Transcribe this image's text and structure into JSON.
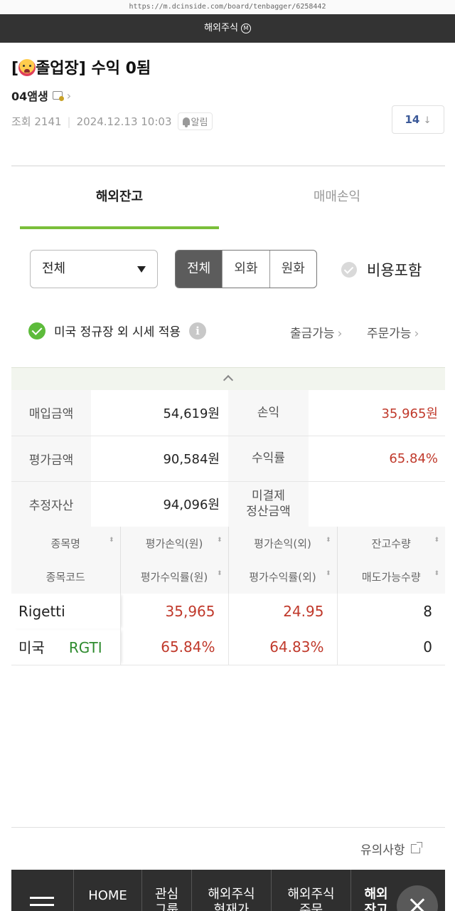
{
  "browser": {
    "url": "https://m.dcinside.com/board/tenbagger/6258442"
  },
  "gallery": {
    "name": "해외주식",
    "badge": "M"
  },
  "post": {
    "title_prefix": "[",
    "title_emoji": "hot-face-emoji",
    "title_tag_text": "졸업장]",
    "title_text": "수익 0됨",
    "author": "04앰생",
    "views_label": "조회 2141",
    "datetime": "2024.12.13 10:03",
    "alarm_label": "알림",
    "comment_count": "14",
    "comment_arrow": "↓"
  },
  "tabs": {
    "active": "해외잔고",
    "inactive": "매매손익"
  },
  "filters": {
    "dropdown_value": "전체",
    "segments": [
      "전체",
      "외화",
      "원화"
    ],
    "include_fees_label": "비용포함"
  },
  "options": {
    "us_after_hours_label": "미국 정규장 외 시세 적용",
    "info_icon": "i",
    "withdrawable_label": "출금가능",
    "orderable_label": "주문가능",
    "chevron": "›"
  },
  "summary": {
    "purchase_label": "매입금액",
    "purchase_value": "54,619원",
    "pnl_label": "손익",
    "pnl_value": "35,965원",
    "eval_label": "평가금액",
    "eval_value": "90,584원",
    "return_label": "수익률",
    "return_value": "65.84%",
    "est_assets_label": "추정자산",
    "est_assets_value": "94,096원",
    "unsettled_label_1": "미결제",
    "unsettled_label_2": "정산금액"
  },
  "holdings": {
    "headers_row1": [
      "종목명",
      "평가손익(원)",
      "평가손익(외)",
      "잔고수량"
    ],
    "headers_row2": [
      "종목코드",
      "평가수익률(원)",
      "평가수익률(외)",
      "매도가능수량"
    ],
    "sort_icon": "⬍",
    "rows": [
      {
        "name": "Rigetti",
        "market": "미국",
        "code": "RGTI",
        "pnl_krw": "35,965",
        "pnl_fx": "24.95",
        "qty": "8",
        "ret_krw": "65.84%",
        "ret_fx": "64.83%",
        "sellable_qty": "0"
      }
    ]
  },
  "footer": {
    "notice_label": "유의사항"
  },
  "bottom_nav": {
    "home": "HOME",
    "watchlist_1": "관심",
    "watchlist_2": "그룹",
    "quote_1": "해외주식",
    "quote_2": "현재가",
    "order_1": "해외주식",
    "order_2": "주문",
    "balance_1": "해외",
    "balance_2": "잔고"
  },
  "colors": {
    "accent_green": "#7bbf3a",
    "profit_red": "#c0392b",
    "code_green": "#2e8b2e",
    "header_dark": "#333333",
    "nav_dark": "#2f2f2f"
  }
}
